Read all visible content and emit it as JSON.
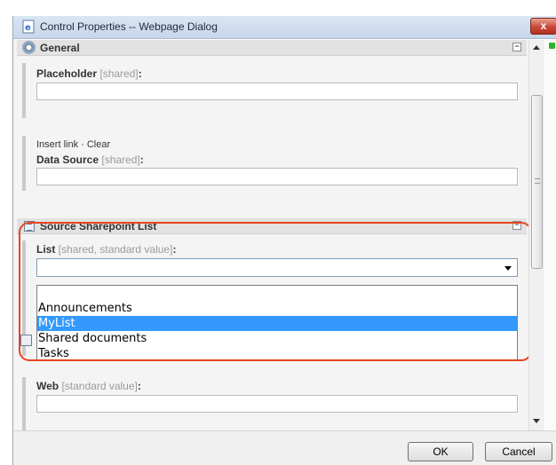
{
  "window": {
    "title": "Control Properties -- Webpage Dialog",
    "close_label": "x"
  },
  "general": {
    "header": "General",
    "collapse_label": "−",
    "placeholder_label": "Placeholder",
    "placeholder_sub": " [shared]",
    "colon": ":",
    "insert_link": "Insert link",
    "separator": " · ",
    "clear": "Clear",
    "datasource_label": "Data Source",
    "datasource_sub": " [shared]"
  },
  "source": {
    "header": "Source Sharepoint List",
    "collapse_label": "−",
    "list_label": "List",
    "list_sub": " [shared, standard value]",
    "colon": ":",
    "list_value": "",
    "options": [
      "",
      "Announcements",
      "MyList",
      "Shared documents",
      "Tasks"
    ],
    "selected_option": "MyList",
    "web_label": "Web",
    "web_sub": " [standard value]"
  },
  "footer": {
    "ok_label": "OK",
    "cancel_label": "Cancel"
  },
  "colors": {
    "highlight": "#e8451f",
    "selection": "#3399ff"
  },
  "icons": [
    "ie-page-icon",
    "gear-icon",
    "list-icon",
    "close-icon",
    "scroll-up-icon",
    "scroll-down-icon"
  ]
}
